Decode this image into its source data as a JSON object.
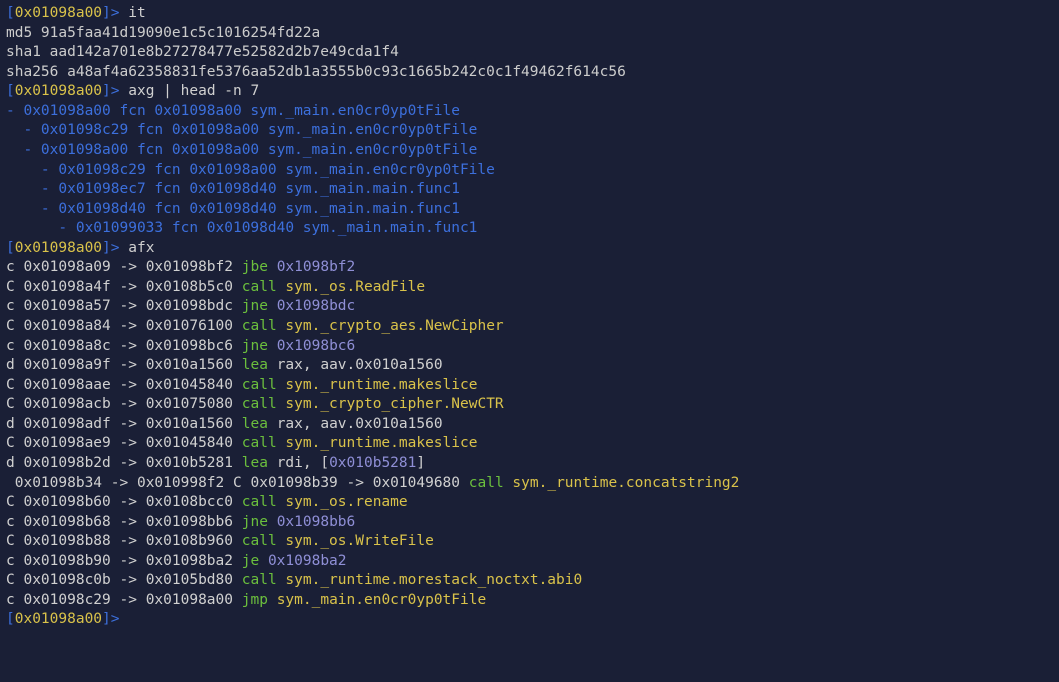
{
  "prompt_addr": "0x01098a00",
  "commands": {
    "c1": "it",
    "c2": "axg | head -n 7",
    "c3": "afx"
  },
  "hashes": {
    "md5": "md5 91a5faa41d19090e1c5c1016254fd22a",
    "sha1": "sha1 aad142a701e8b27278477e52582d2b7e49cda1f4",
    "sha256": "sha256 a48af4a62358831fe5376aa52db1a3555b0c93c1665b242c0c1f49462f614c56"
  },
  "axg": [
    "- 0x01098a00 fcn 0x01098a00 sym._main.en0cr0yp0tFile",
    "  - 0x01098c29 fcn 0x01098a00 sym._main.en0cr0yp0tFile",
    "  - 0x01098a00 fcn 0x01098a00 sym._main.en0cr0yp0tFile",
    "    - 0x01098c29 fcn 0x01098a00 sym._main.en0cr0yp0tFile",
    "    - 0x01098ec7 fcn 0x01098d40 sym._main.main.func1",
    "    - 0x01098d40 fcn 0x01098d40 sym._main.main.func1",
    "      - 0x01099033 fcn 0x01098d40 sym._main.main.func1"
  ],
  "afx": [
    {
      "p": "c ",
      "a": "0x01098a09",
      "b": "0x01098bf2",
      "op": "jbe",
      "arg": "0x1098bf2",
      "argc": "violet"
    },
    {
      "p": "C ",
      "a": "0x01098a4f",
      "b": "0x0108b5c0",
      "op": "call",
      "arg": "sym._os.ReadFile",
      "argc": "yellow"
    },
    {
      "p": "c ",
      "a": "0x01098a57",
      "b": "0x01098bdc",
      "op": "jne",
      "arg": "0x1098bdc",
      "argc": "violet"
    },
    {
      "p": "C ",
      "a": "0x01098a84",
      "b": "0x01076100",
      "op": "call",
      "arg": "sym._crypto_aes.NewCipher",
      "argc": "yellow"
    },
    {
      "p": "c ",
      "a": "0x01098a8c",
      "b": "0x01098bc6",
      "op": "jne",
      "arg": "0x1098bc6",
      "argc": "violet"
    },
    {
      "p": "d ",
      "a": "0x01098a9f",
      "b": "0x010a1560",
      "op": "lea",
      "arg": "rax, aav.0x010a1560",
      "argc": "white"
    },
    {
      "p": "C ",
      "a": "0x01098aae",
      "b": "0x01045840",
      "op": "call",
      "arg": "sym._runtime.makeslice",
      "argc": "yellow"
    },
    {
      "p": "C ",
      "a": "0x01098acb",
      "b": "0x01075080",
      "op": "call",
      "arg": "sym._crypto_cipher.NewCTR",
      "argc": "yellow"
    },
    {
      "p": "d ",
      "a": "0x01098adf",
      "b": "0x010a1560",
      "op": "lea",
      "arg": "rax, aav.0x010a1560",
      "argc": "white"
    },
    {
      "p": "C ",
      "a": "0x01098ae9",
      "b": "0x01045840",
      "op": "call",
      "arg": "sym._runtime.makeslice",
      "argc": "yellow"
    }
  ],
  "lea_line": {
    "p": "d ",
    "a": "0x01098b2d",
    "b": "0x010b5281",
    "op": "lea",
    "pre": "rdi, [",
    "addr": "0x010b5281",
    "post": "]"
  },
  "concat_line": {
    "p1": " ",
    "a1": "0x01098b34",
    "b1": "0x010998f2",
    "mid": " C ",
    "a2": "0x01098b39",
    "b2": "0x01049680",
    "op": "call",
    "arg": "sym._runtime.concatstring2"
  },
  "afx2": [
    {
      "p": "C ",
      "a": "0x01098b60",
      "b": "0x0108bcc0",
      "op": "call",
      "arg": "sym._os.rename",
      "argc": "yellow"
    },
    {
      "p": "c ",
      "a": "0x01098b68",
      "b": "0x01098bb6",
      "op": "jne",
      "arg": "0x1098bb6",
      "argc": "violet"
    },
    {
      "p": "C ",
      "a": "0x01098b88",
      "b": "0x0108b960",
      "op": "call",
      "arg": "sym._os.WriteFile",
      "argc": "yellow"
    },
    {
      "p": "c ",
      "a": "0x01098b90",
      "b": "0x01098ba2",
      "op": "je",
      "arg": "0x1098ba2",
      "argc": "violet"
    },
    {
      "p": "C ",
      "a": "0x01098c0b",
      "b": "0x0105bd80",
      "op": "call",
      "arg": "sym._runtime.morestack_noctxt.abi0",
      "argc": "yellow"
    },
    {
      "p": "c ",
      "a": "0x01098c29",
      "b": "0x01098a00",
      "op": "jmp",
      "arg": "sym._main.en0cr0yp0tFile",
      "argc": "yellow"
    }
  ]
}
